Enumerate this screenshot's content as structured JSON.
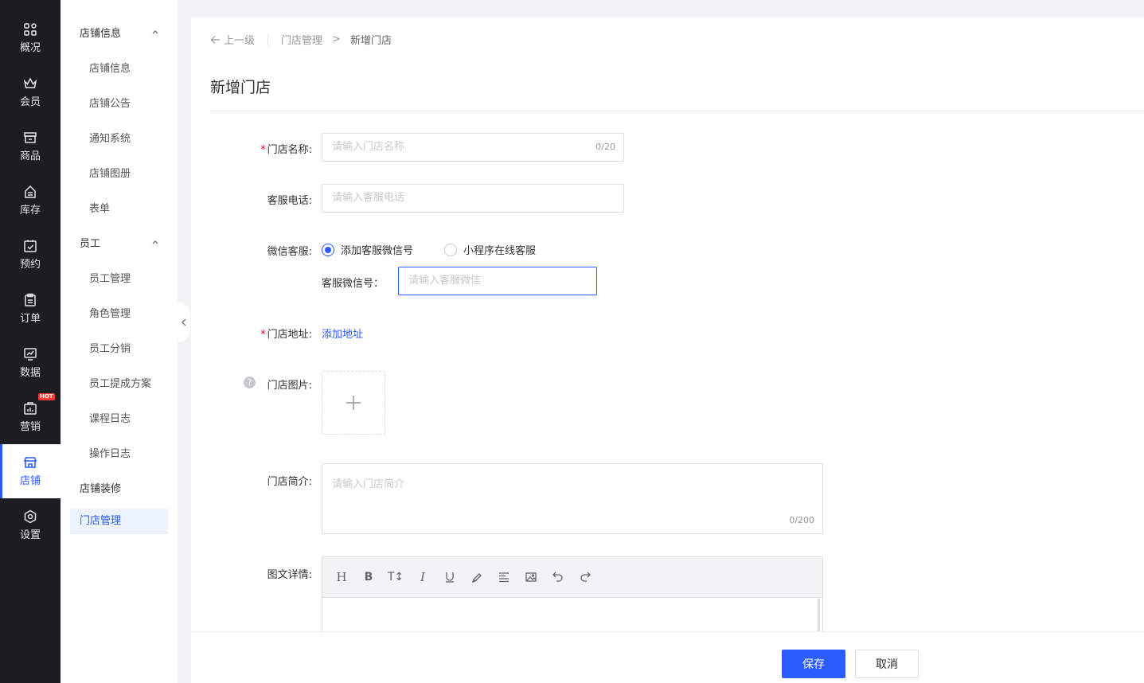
{
  "nav": {
    "items": [
      {
        "label": "概况",
        "icon": "overview-icon"
      },
      {
        "label": "会员",
        "icon": "crown-icon"
      },
      {
        "label": "商品",
        "icon": "shop-icon"
      },
      {
        "label": "库存",
        "icon": "inventory-icon"
      },
      {
        "label": "预约",
        "icon": "calendar-check-icon"
      },
      {
        "label": "订单",
        "icon": "clipboard-icon"
      },
      {
        "label": "数据",
        "icon": "chart-icon"
      },
      {
        "label": "营销",
        "icon": "marketing-icon",
        "badge": "HOT"
      },
      {
        "label": "店铺",
        "icon": "store-icon",
        "active": true
      },
      {
        "label": "设置",
        "icon": "gear-icon"
      }
    ]
  },
  "subnav": {
    "group_store": "店铺信息",
    "store_items": [
      "店铺信息",
      "店铺公告",
      "通知系统",
      "店铺图册",
      "表单"
    ],
    "group_staff": "员工",
    "staff_items": [
      "员工管理",
      "角色管理",
      "员工分销",
      "员工提成方案",
      "课程日志",
      "操作日志"
    ],
    "decor": "店铺装修",
    "active": "门店管理"
  },
  "breadcrumb": {
    "back": "上一级",
    "parent": "门店管理",
    "separator": ">",
    "current": "新增门店"
  },
  "page": {
    "title": "新增门店"
  },
  "form": {
    "name": {
      "label": "门店名称:",
      "placeholder": "请输入门店名称",
      "counter": "0/20"
    },
    "phone": {
      "label": "客服电话:",
      "placeholder": "请输入客服电话"
    },
    "wechat": {
      "label": "微信客服:",
      "options": [
        "添加客服微信号",
        "小程序在线客服"
      ],
      "selected": "添加客服微信号",
      "sub_label": "客服微信号：",
      "sub_placeholder": "请输入客服微信"
    },
    "address": {
      "label": "门店地址:",
      "link": "添加地址"
    },
    "images": {
      "label": "门店图片:",
      "help": "?"
    },
    "intro": {
      "label": "门店简介:",
      "placeholder": "请输入门店简介",
      "counter": "0/200"
    },
    "detail": {
      "label": "图文详情:"
    }
  },
  "editor_toolbar": [
    "heading",
    "bold",
    "font-size",
    "italic",
    "underline",
    "highlight",
    "align",
    "image",
    "undo",
    "redo"
  ],
  "footer": {
    "save": "保存",
    "cancel": "取消"
  },
  "colors": {
    "accent": "#2b5cff",
    "nav_bg": "#1b1d21",
    "required": "#ee0a24"
  }
}
